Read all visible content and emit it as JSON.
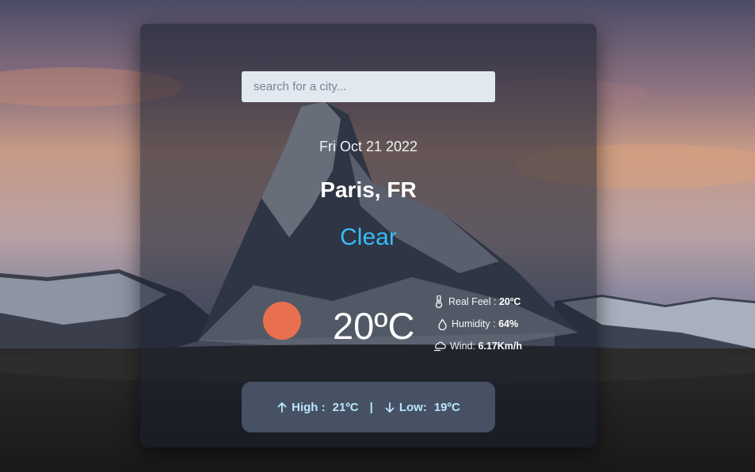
{
  "search": {
    "placeholder": "search for a city..."
  },
  "weather": {
    "date": "Fri Oct 21 2022",
    "location": "Paris, FR",
    "condition": "Clear",
    "temperature": "20ºC",
    "real_feel_label": "Real Feel :",
    "real_feel_value": "20ºC",
    "humidity_label": "Humidity :",
    "humidity_value": "64%",
    "wind_label": "Wind:",
    "wind_value": "6.17Km/h"
  },
  "range": {
    "high_label": "High :",
    "high_value": "21ºC",
    "separator": "|",
    "low_label": "Low:",
    "low_value": "19ºC"
  },
  "icons": {
    "condition": "sun-icon",
    "real_feel": "thermometer-icon",
    "humidity": "droplet-icon",
    "wind": "wind-icon",
    "high": "arrow-up-icon",
    "low": "arrow-down-icon"
  },
  "colors": {
    "condition_text": "#38bdf8",
    "sun": "#e9704f",
    "range_text": "#bae6fd"
  }
}
